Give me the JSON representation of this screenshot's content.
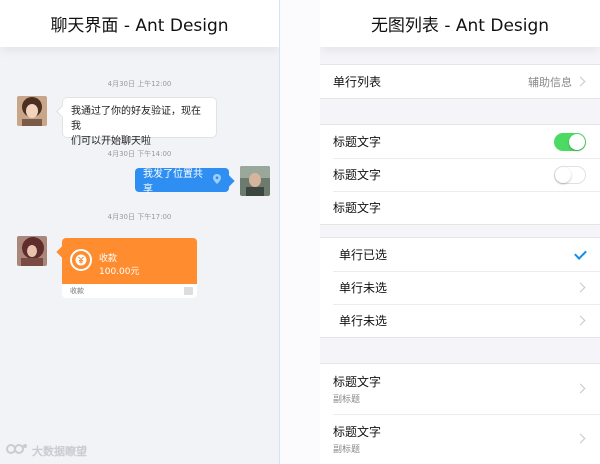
{
  "chat": {
    "title": "聊天界面 - Ant Design",
    "messages": [
      {
        "time": "4月30日 上午12:00"
      },
      {
        "text_line1": "我通过了你的好友验证，现在我",
        "text_line2": "们可以开始聊天啦"
      },
      {
        "time": "4月30日 下午14:00"
      },
      {
        "text": "我发了位置共享"
      },
      {
        "time": "4月30日 下午17:00"
      }
    ],
    "payment": {
      "title": "收款",
      "amount": "100.00元",
      "footer": "收款"
    },
    "watermark": "大数据瞭望"
  },
  "list": {
    "title": "无图列表 - Ant Design",
    "single_row": {
      "label": "单行列表",
      "extra": "辅助信息"
    },
    "switch_rows": [
      {
        "label": "标题文字",
        "on": true
      },
      {
        "label": "标题文字",
        "on": false
      },
      {
        "label": "标题文字"
      }
    ],
    "select_rows": [
      {
        "label": "单行已选",
        "selected": true
      },
      {
        "label": "单行未选",
        "selected": false
      },
      {
        "label": "单行未选",
        "selected": false
      }
    ],
    "detail_rows": [
      {
        "title": "标题文字",
        "brief": "副标题"
      },
      {
        "title": "标题文字",
        "brief": "副标题"
      }
    ]
  },
  "colors": {
    "accent_blue": "#2f8ef1",
    "switch_on": "#4cd964",
    "pay_orange": "#ff8c2e",
    "check": "#108ee9"
  }
}
